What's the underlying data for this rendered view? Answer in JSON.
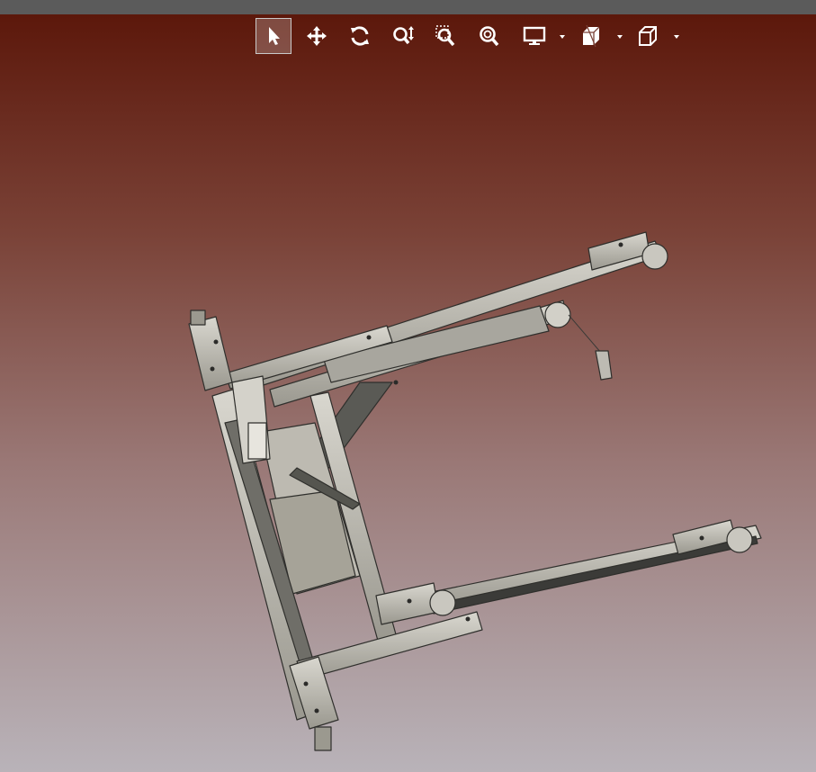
{
  "viewer": {
    "background_top": "#5a1508",
    "background_bottom": "#b9b3b9"
  },
  "toolbar": {
    "buttons": [
      {
        "name": "select-button",
        "icon": "cursor-arrow-icon",
        "active": true
      },
      {
        "name": "pan-button",
        "icon": "move-arrows-icon",
        "active": false
      },
      {
        "name": "rotate-button",
        "icon": "rotate-icon",
        "active": false
      },
      {
        "name": "zoom-in-out-button",
        "icon": "zoom-updown-icon",
        "active": false
      },
      {
        "name": "zoom-window-button",
        "icon": "zoom-window-icon",
        "active": false
      },
      {
        "name": "zoom-fit-button",
        "icon": "zoom-fit-icon",
        "active": false
      },
      {
        "name": "display-mode-button",
        "icon": "monitor-icon",
        "active": false,
        "dropdown": true
      },
      {
        "name": "section-view-button",
        "icon": "section-cube-icon",
        "active": false,
        "dropdown": true
      },
      {
        "name": "view-orientation-button",
        "icon": "cube-icon",
        "active": false,
        "dropdown": true
      }
    ]
  },
  "model": {
    "description_icon": "mechanical-assembly-icon",
    "metal_color": "#bfbdb4",
    "dark_color": "#4a4a46"
  }
}
